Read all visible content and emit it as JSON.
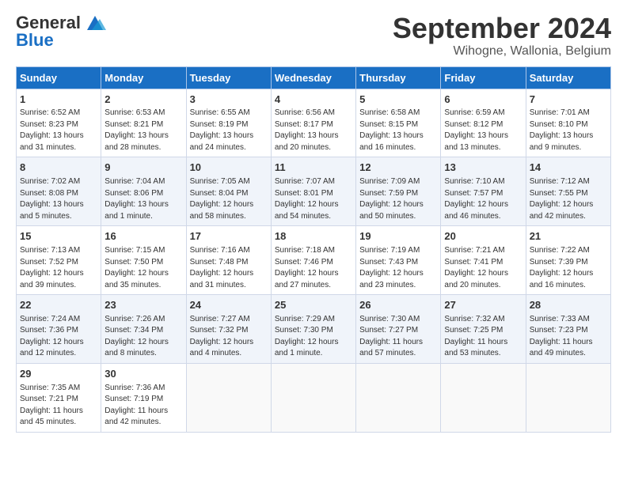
{
  "header": {
    "logo_line1": "General",
    "logo_line2": "Blue",
    "month": "September 2024",
    "location": "Wihogne, Wallonia, Belgium"
  },
  "days_of_week": [
    "Sunday",
    "Monday",
    "Tuesday",
    "Wednesday",
    "Thursday",
    "Friday",
    "Saturday"
  ],
  "weeks": [
    [
      {
        "day": "1",
        "rise": "6:52 AM",
        "set": "8:23 PM",
        "daylight": "13 hours and 31 minutes."
      },
      {
        "day": "2",
        "rise": "6:53 AM",
        "set": "8:21 PM",
        "daylight": "13 hours and 28 minutes."
      },
      {
        "day": "3",
        "rise": "6:55 AM",
        "set": "8:19 PM",
        "daylight": "13 hours and 24 minutes."
      },
      {
        "day": "4",
        "rise": "6:56 AM",
        "set": "8:17 PM",
        "daylight": "13 hours and 20 minutes."
      },
      {
        "day": "5",
        "rise": "6:58 AM",
        "set": "8:15 PM",
        "daylight": "13 hours and 16 minutes."
      },
      {
        "day": "6",
        "rise": "6:59 AM",
        "set": "8:12 PM",
        "daylight": "13 hours and 13 minutes."
      },
      {
        "day": "7",
        "rise": "7:01 AM",
        "set": "8:10 PM",
        "daylight": "13 hours and 9 minutes."
      }
    ],
    [
      {
        "day": "8",
        "rise": "7:02 AM",
        "set": "8:08 PM",
        "daylight": "13 hours and 5 minutes."
      },
      {
        "day": "9",
        "rise": "7:04 AM",
        "set": "8:06 PM",
        "daylight": "13 hours and 1 minute."
      },
      {
        "day": "10",
        "rise": "7:05 AM",
        "set": "8:04 PM",
        "daylight": "12 hours and 58 minutes."
      },
      {
        "day": "11",
        "rise": "7:07 AM",
        "set": "8:01 PM",
        "daylight": "12 hours and 54 minutes."
      },
      {
        "day": "12",
        "rise": "7:09 AM",
        "set": "7:59 PM",
        "daylight": "12 hours and 50 minutes."
      },
      {
        "day": "13",
        "rise": "7:10 AM",
        "set": "7:57 PM",
        "daylight": "12 hours and 46 minutes."
      },
      {
        "day": "14",
        "rise": "7:12 AM",
        "set": "7:55 PM",
        "daylight": "12 hours and 42 minutes."
      }
    ],
    [
      {
        "day": "15",
        "rise": "7:13 AM",
        "set": "7:52 PM",
        "daylight": "12 hours and 39 minutes."
      },
      {
        "day": "16",
        "rise": "7:15 AM",
        "set": "7:50 PM",
        "daylight": "12 hours and 35 minutes."
      },
      {
        "day": "17",
        "rise": "7:16 AM",
        "set": "7:48 PM",
        "daylight": "12 hours and 31 minutes."
      },
      {
        "day": "18",
        "rise": "7:18 AM",
        "set": "7:46 PM",
        "daylight": "12 hours and 27 minutes."
      },
      {
        "day": "19",
        "rise": "7:19 AM",
        "set": "7:43 PM",
        "daylight": "12 hours and 23 minutes."
      },
      {
        "day": "20",
        "rise": "7:21 AM",
        "set": "7:41 PM",
        "daylight": "12 hours and 20 minutes."
      },
      {
        "day": "21",
        "rise": "7:22 AM",
        "set": "7:39 PM",
        "daylight": "12 hours and 16 minutes."
      }
    ],
    [
      {
        "day": "22",
        "rise": "7:24 AM",
        "set": "7:36 PM",
        "daylight": "12 hours and 12 minutes."
      },
      {
        "day": "23",
        "rise": "7:26 AM",
        "set": "7:34 PM",
        "daylight": "12 hours and 8 minutes."
      },
      {
        "day": "24",
        "rise": "7:27 AM",
        "set": "7:32 PM",
        "daylight": "12 hours and 4 minutes."
      },
      {
        "day": "25",
        "rise": "7:29 AM",
        "set": "7:30 PM",
        "daylight": "12 hours and 1 minute."
      },
      {
        "day": "26",
        "rise": "7:30 AM",
        "set": "7:27 PM",
        "daylight": "11 hours and 57 minutes."
      },
      {
        "day": "27",
        "rise": "7:32 AM",
        "set": "7:25 PM",
        "daylight": "11 hours and 53 minutes."
      },
      {
        "day": "28",
        "rise": "7:33 AM",
        "set": "7:23 PM",
        "daylight": "11 hours and 49 minutes."
      }
    ],
    [
      {
        "day": "29",
        "rise": "7:35 AM",
        "set": "7:21 PM",
        "daylight": "11 hours and 45 minutes."
      },
      {
        "day": "30",
        "rise": "7:36 AM",
        "set": "7:19 PM",
        "daylight": "11 hours and 42 minutes."
      },
      null,
      null,
      null,
      null,
      null
    ]
  ]
}
